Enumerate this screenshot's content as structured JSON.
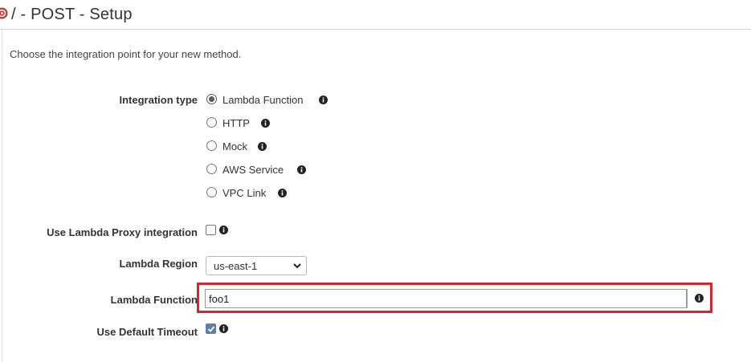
{
  "header": {
    "title": "/ - POST - Setup",
    "icon": "aws-api-icon"
  },
  "intro": "Choose the integration point for your new method.",
  "integration_type": {
    "label": "Integration type",
    "options": [
      {
        "label": "Lambda Function",
        "selected": true
      },
      {
        "label": "HTTP",
        "selected": false
      },
      {
        "label": "Mock",
        "selected": false
      },
      {
        "label": "AWS Service",
        "selected": false
      },
      {
        "label": "VPC Link",
        "selected": false
      }
    ]
  },
  "proxy": {
    "label": "Use Lambda Proxy integration",
    "checked": false
  },
  "region": {
    "label": "Lambda Region",
    "value": "us-east-1"
  },
  "function": {
    "label": "Lambda Function",
    "value": "foo1"
  },
  "timeout": {
    "label": "Use Default Timeout",
    "checked": true
  },
  "colors": {
    "highlight": "#d7262b",
    "checkbox_checked": "#5f7ea3",
    "header_border": "#d5d5d5"
  }
}
